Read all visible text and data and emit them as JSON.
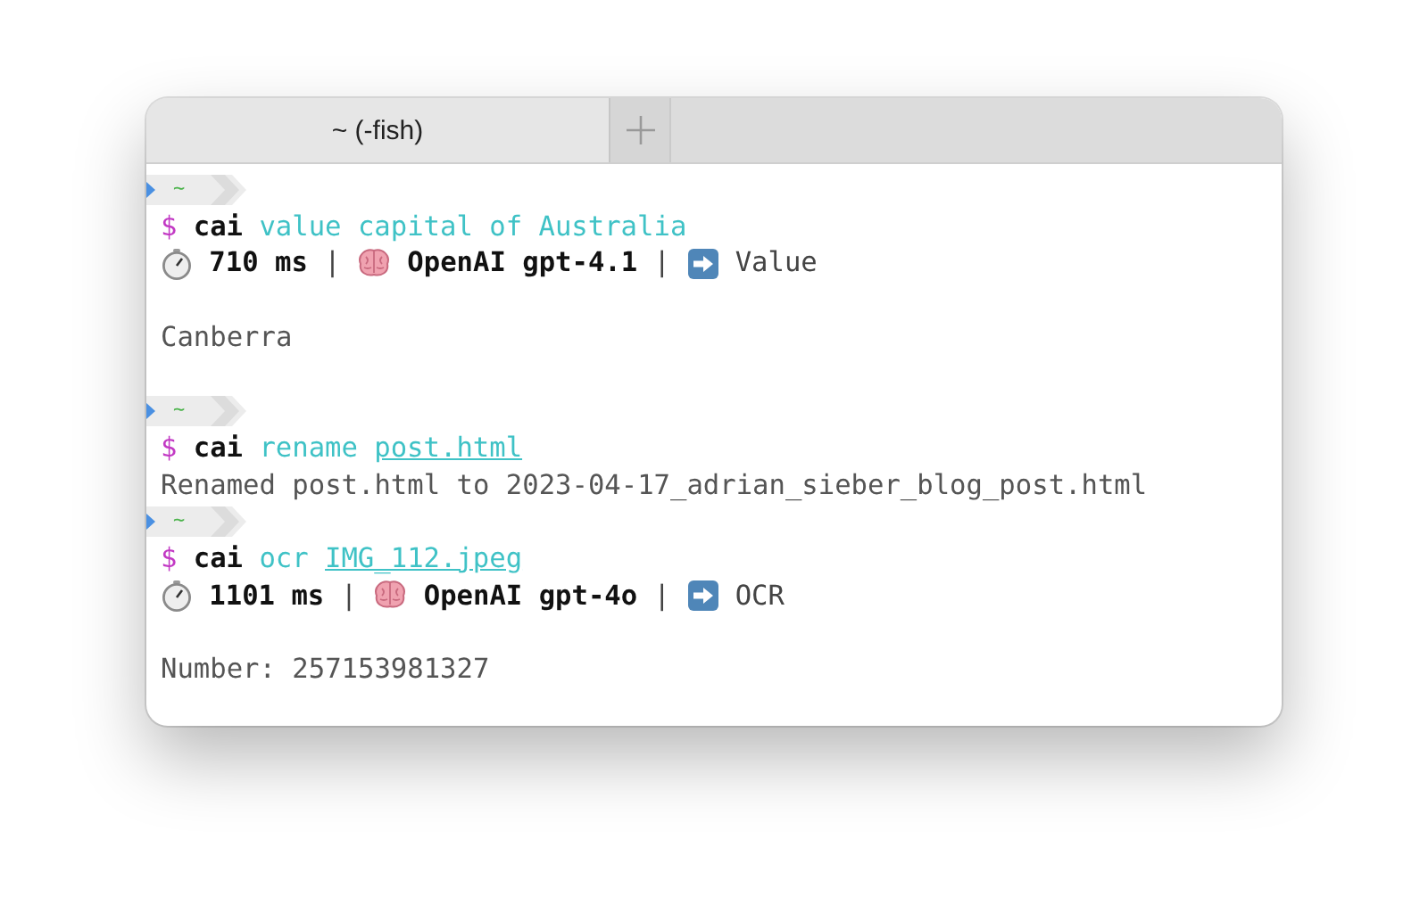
{
  "tabs": [
    {
      "label": "~ (-fish)",
      "selected": true
    }
  ],
  "lines": [
    {
      "kind": "prompt",
      "dir": "~"
    },
    {
      "kind": "command",
      "sigil": "$",
      "program": "cai",
      "args": [
        {
          "text": "value capital of Australia",
          "underline": false
        }
      ]
    },
    {
      "kind": "status",
      "time": "710 ms",
      "separator": "|",
      "model": "OpenAI gpt-4.1",
      "mode": "Value"
    },
    {
      "kind": "blank"
    },
    {
      "kind": "output",
      "text": "Canberra"
    },
    {
      "kind": "blank"
    },
    {
      "kind": "prompt",
      "dir": "~"
    },
    {
      "kind": "command",
      "sigil": "$",
      "program": "cai",
      "args": [
        {
          "text": "rename",
          "underline": false
        },
        {
          "text": "post.html",
          "underline": true
        }
      ]
    },
    {
      "kind": "output",
      "text": "Renamed post.html to 2023-04-17_adrian_sieber_blog_post.html"
    },
    {
      "kind": "prompt",
      "dir": "~"
    },
    {
      "kind": "command",
      "sigil": "$",
      "program": "cai",
      "args": [
        {
          "text": "ocr",
          "underline": false
        },
        {
          "text": "IMG_112.jpeg",
          "underline": true
        }
      ]
    },
    {
      "kind": "status",
      "time": "1101 ms",
      "separator": "|",
      "model": "OpenAI gpt-4o",
      "mode": "OCR"
    },
    {
      "kind": "blank"
    },
    {
      "kind": "output",
      "text": "Number: 257153981327"
    }
  ]
}
